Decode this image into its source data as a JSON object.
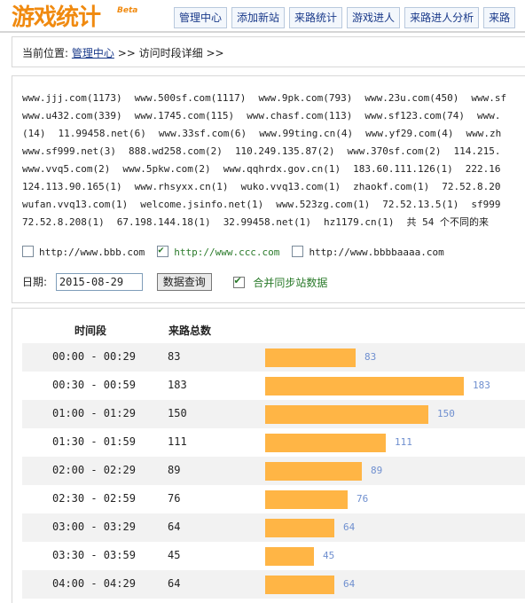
{
  "header": {
    "logo": "游戏统计",
    "beta": "Beta",
    "nav": [
      "管理中心",
      "添加新站",
      "来路统计",
      "游戏进人",
      "来路进人分析",
      "来路"
    ]
  },
  "breadcrumb": {
    "prefix": "当前位置:",
    "link": "管理中心",
    "sep1": ">>",
    "current": "访问时段详细",
    "sep2": ">>"
  },
  "sites": {
    "rows": [
      [
        {
          "t": "www.jjj.com(1173)"
        },
        {
          "t": "www.500sf.com(1117)"
        },
        {
          "t": "www.9pk.com(793)"
        },
        {
          "t": "www.23u.com(450)"
        },
        {
          "t": "www.sf"
        }
      ],
      [
        {
          "t": "www.u432.com(339)"
        },
        {
          "t": "www.1745.com(115)"
        },
        {
          "t": "www.chasf.com(113)"
        },
        {
          "t": "www.sf123.com(74)"
        },
        {
          "t": "www."
        }
      ],
      [
        {
          "t": "(14)"
        },
        {
          "t": "11.99458.net(6)"
        },
        {
          "t": "www.33sf.com(6)"
        },
        {
          "t": "www.99ting.cn(4)"
        },
        {
          "t": "www.yf29.com(4)"
        },
        {
          "t": "www.zh"
        }
      ],
      [
        {
          "t": "www.sf999.net(3)"
        },
        {
          "t": "888.wd258.com(2)"
        },
        {
          "t": "110.249.135.87(2)"
        },
        {
          "t": "www.370sf.com(2)"
        },
        {
          "t": "114.215."
        }
      ],
      [
        {
          "t": "www.vvq5.com(2)"
        },
        {
          "t": "www.5pkw.com(2)"
        },
        {
          "t": "www.qqhrdx.gov.cn(1)"
        },
        {
          "t": "183.60.111.126(1)"
        },
        {
          "t": "222.16"
        }
      ],
      [
        {
          "t": "124.113.90.165(1)"
        },
        {
          "t": "www.rhsyxx.cn(1)"
        },
        {
          "t": "wuko.vvq13.com(1)"
        },
        {
          "t": "zhaokf.com(1)"
        },
        {
          "t": "72.52.8.20"
        }
      ],
      [
        {
          "t": "wufan.vvq13.com(1)"
        },
        {
          "t": "welcome.jsinfo.net(1)"
        },
        {
          "t": "www.523zg.com(1)"
        },
        {
          "t": "72.52.13.5(1)"
        },
        {
          "t": "sf999"
        }
      ],
      [
        {
          "t": "72.52.8.208(1)"
        },
        {
          "t": "67.198.144.18(1)"
        },
        {
          "t": "32.99458.net(1)"
        },
        {
          "t": "hz1179.cn(1)"
        },
        {
          "t": "共 54 个不同的来",
          "red": false
        }
      ]
    ]
  },
  "site_filters": [
    {
      "label": "http://www.bbb.com",
      "checked": false
    },
    {
      "label": "http://www.ccc.com",
      "checked": true
    },
    {
      "label": "http://www.bbbbaaaa.com",
      "checked": false
    }
  ],
  "date": {
    "label": "日期:",
    "value": "2015-08-29",
    "query_button": "数据查询",
    "merge_label": "合并同步站数据",
    "merge_checked": true
  },
  "table": {
    "col_time": "时间段",
    "col_count": "来路总数",
    "max_value": 183,
    "rows": [
      {
        "time": "00:00 - 00:29",
        "count": "83",
        "value": 83
      },
      {
        "time": "00:30 - 00:59",
        "count": "183",
        "value": 183
      },
      {
        "time": "01:00 - 01:29",
        "count": "150",
        "value": 150
      },
      {
        "time": "01:30 - 01:59",
        "count": "111",
        "value": 111
      },
      {
        "time": "02:00 - 02:29",
        "count": "89",
        "value": 89
      },
      {
        "time": "02:30 - 02:59",
        "count": "76",
        "value": 76
      },
      {
        "time": "03:00 - 03:29",
        "count": "64",
        "value": 64
      },
      {
        "time": "03:30 - 03:59",
        "count": "45",
        "value": 45
      },
      {
        "time": "04:00 - 04:29",
        "count": "64",
        "value": 64
      }
    ]
  },
  "colors": {
    "bar": "#ffb545",
    "bar_label": "#6f8fcf",
    "logo": "#f08a10",
    "link": "#1a3a8a",
    "green": "#2a7a2a"
  }
}
